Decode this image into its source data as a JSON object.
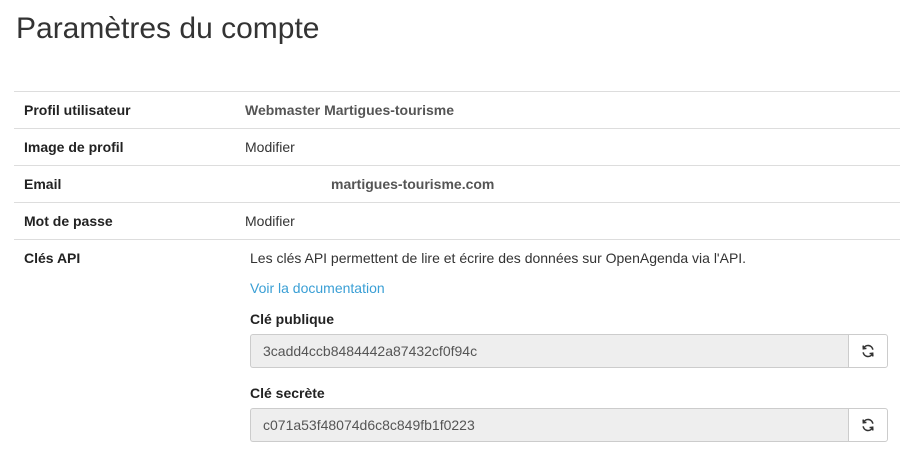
{
  "page_title": "Paramètres du compte",
  "rows": {
    "profile": {
      "label": "Profil utilisateur",
      "value": "Webmaster Martigues-tourisme"
    },
    "image": {
      "label": "Image de profil",
      "value": "Modifier"
    },
    "email": {
      "label": "Email",
      "value": "martigues-tourisme.com"
    },
    "password": {
      "label": "Mot de passe",
      "value": "Modifier"
    },
    "api": {
      "label": "Clés API",
      "description": "Les clés API permettent de lire et écrire des données sur OpenAgenda via l'API.",
      "doc_link": "Voir la documentation",
      "public_key_label": "Clé publique",
      "public_key_value": "3cadd4ccb8484442a87432cf0f94c",
      "secret_key_label": "Clé secrète",
      "secret_key_value": "c071a53f48074d6c8c849fb1f0223"
    }
  },
  "icons": {
    "refresh": "refresh-icon"
  },
  "colors": {
    "link": "#3a9fd5",
    "input_bg": "#eeeeee",
    "border": "#dddddd"
  }
}
